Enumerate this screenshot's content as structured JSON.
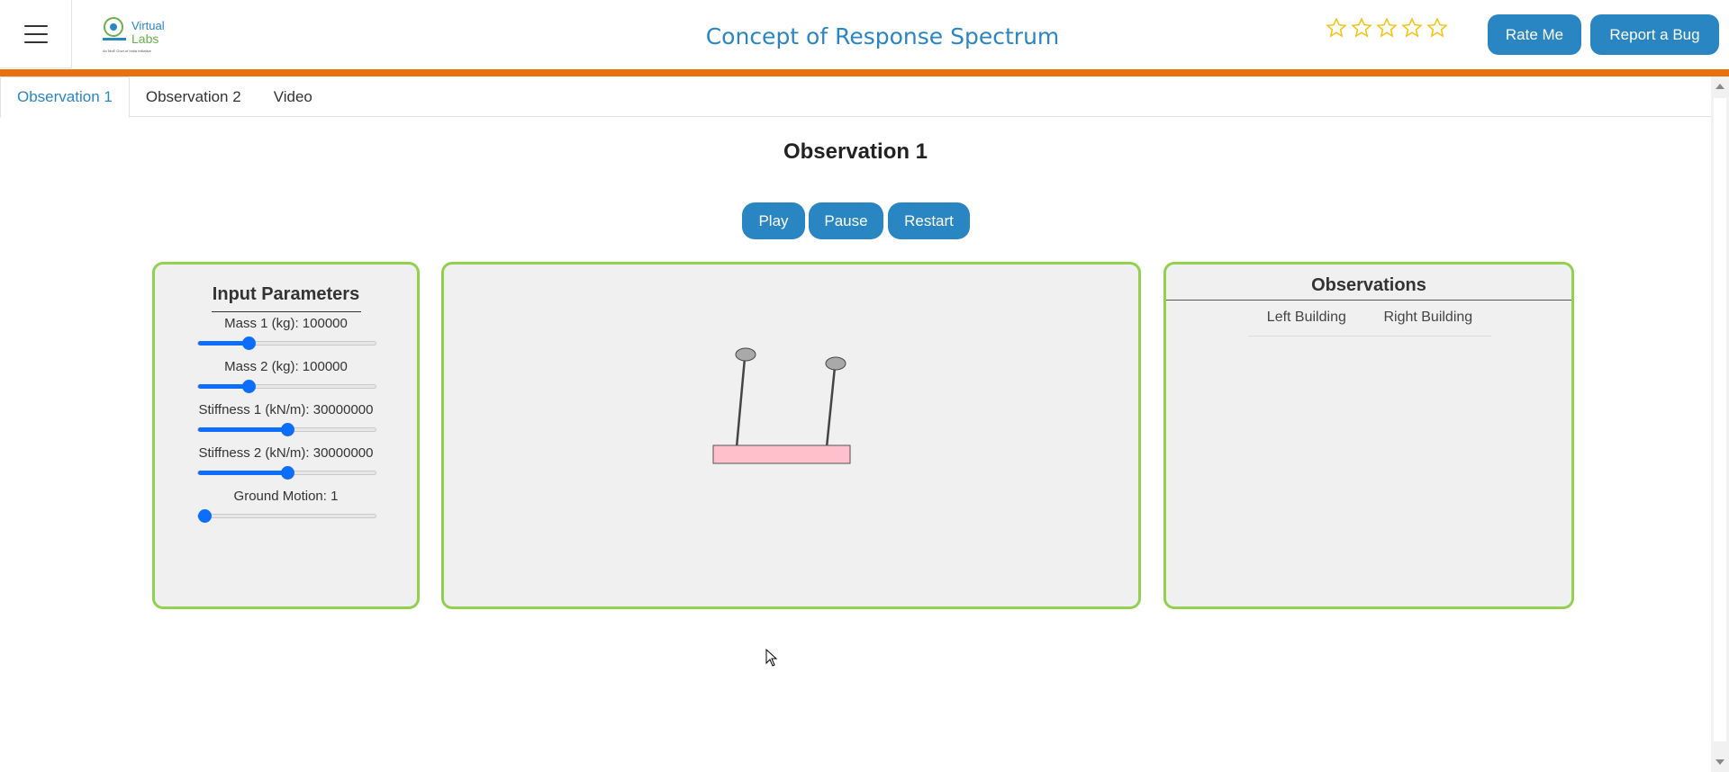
{
  "header": {
    "title": "Concept of Response Spectrum",
    "logo": {
      "line1": "Virtual",
      "line2": "Labs",
      "tagline": "An MoE Govt of India Initiative"
    },
    "rating_stars": 5,
    "rating_value": 0,
    "rate_label": "Rate Me",
    "bug_label": "Report a Bug"
  },
  "tabs": [
    {
      "label": "Observation 1",
      "active": true
    },
    {
      "label": "Observation 2",
      "active": false
    },
    {
      "label": "Video",
      "active": false
    }
  ],
  "main": {
    "heading": "Observation 1",
    "controls": {
      "play": "Play",
      "pause": "Pause",
      "restart": "Restart"
    }
  },
  "inputs": {
    "title": "Input Parameters",
    "params": [
      {
        "label": "Mass 1 (kg): 100000",
        "fraction": 0.27
      },
      {
        "label": "Mass 2 (kg): 100000",
        "fraction": 0.27
      },
      {
        "label": "Stiffness 1 (kN/m): 30000000",
        "fraction": 0.5
      },
      {
        "label": "Stiffness 2 (kN/m): 30000000",
        "fraction": 0.5
      },
      {
        "label": "Ground Motion: 1",
        "fraction": 0.0
      }
    ]
  },
  "observations": {
    "title": "Observations",
    "columns": [
      "Left Building",
      "Right Building"
    ]
  },
  "colors": {
    "accent": "#2a86c2",
    "orange_bar": "#e8700f",
    "panel_border": "#92d050",
    "panel_bg": "#f0f0f0",
    "slider": "#0d6efd",
    "base": "#ffc0cb",
    "mass": "#a9a9a9",
    "star": "#f1c40f"
  },
  "icons": {
    "menu": "hamburger-icon",
    "star": "star-outline-icon",
    "cursor": "mouse-pointer-icon"
  }
}
